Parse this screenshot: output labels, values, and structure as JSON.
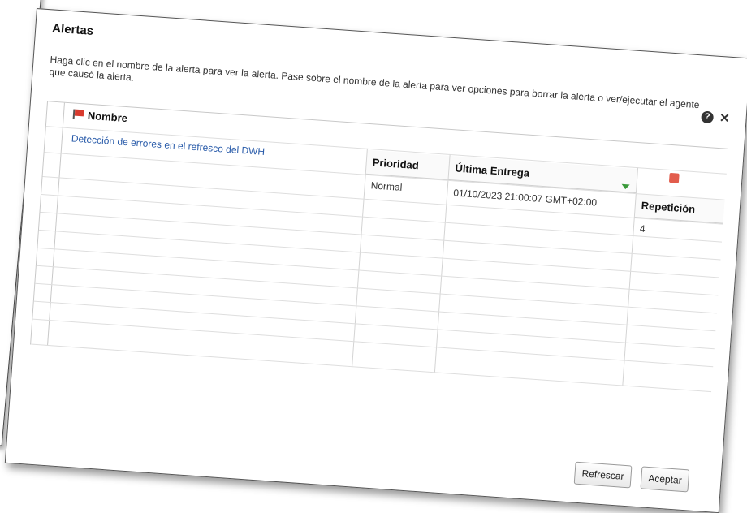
{
  "dialog": {
    "title": "Alertas",
    "description": "Haga clic en el nombre de la alerta para ver la alerta. Pase sobre el nombre de la alerta para ver opciones para borrar la alerta o ver/ejecutar el agente que causó la alerta.",
    "help_glyph": "?",
    "close_glyph": "✕"
  },
  "table": {
    "columns": {
      "nombre": "Nombre",
      "prioridad": "Prioridad",
      "ultima_entrega": "Última Entrega",
      "repeticion": "Repetición"
    },
    "rows": [
      {
        "nombre": "Detección de errores en el refresco del DWH",
        "prioridad": "Normal",
        "ultima_entrega": "01/10/2023 21:00:07 GMT+02:00",
        "repeticion": "4"
      }
    ]
  },
  "footer": {
    "refresh_label": "Refrescar",
    "accept_label": "Aceptar"
  },
  "icons": {
    "flag": "flag-icon",
    "sort": "sort-descending-icon",
    "feed": "rss-feed-icon",
    "help": "help-icon",
    "close": "close-icon"
  }
}
